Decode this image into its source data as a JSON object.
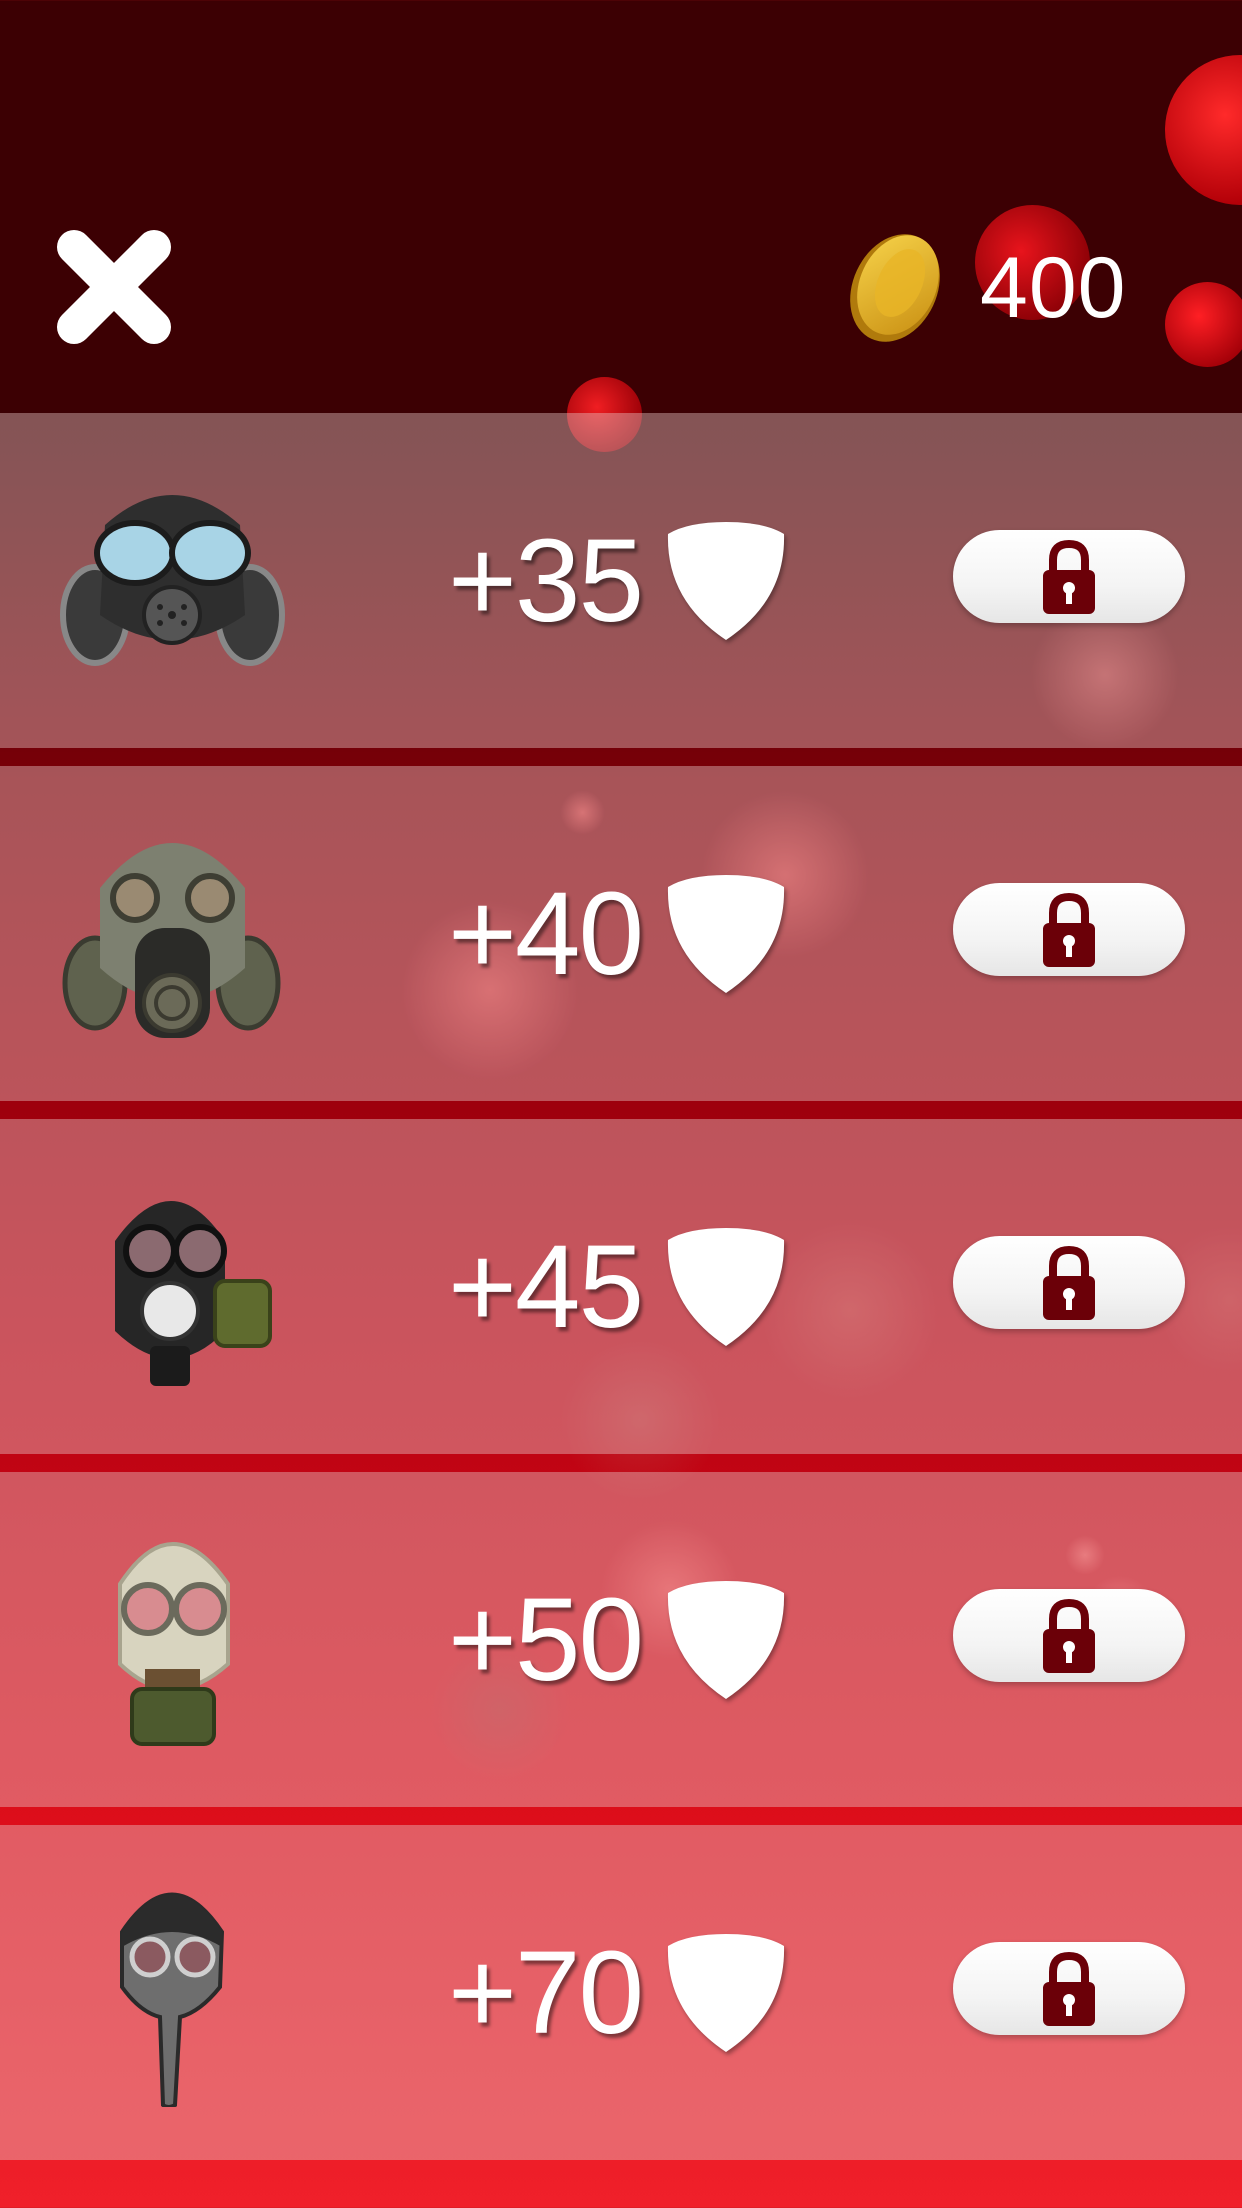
{
  "header": {
    "coins": "400"
  },
  "items": [
    {
      "bonus": "+35",
      "mask": "gas-mask-blue-visor",
      "locked": true
    },
    {
      "bonus": "+40",
      "mask": "gas-mask-grey-military",
      "locked": true
    },
    {
      "bonus": "+45",
      "mask": "gas-mask-black-side-filter",
      "locked": true
    },
    {
      "bonus": "+50",
      "mask": "gas-mask-beige-soviet",
      "locked": true
    },
    {
      "bonus": "+70",
      "mask": "plague-doctor-mask",
      "locked": true
    }
  ],
  "colors": {
    "header_bg": "#3c0003",
    "lock": "#6b0008",
    "coin": "#e3b62c",
    "text": "#ffffff"
  }
}
